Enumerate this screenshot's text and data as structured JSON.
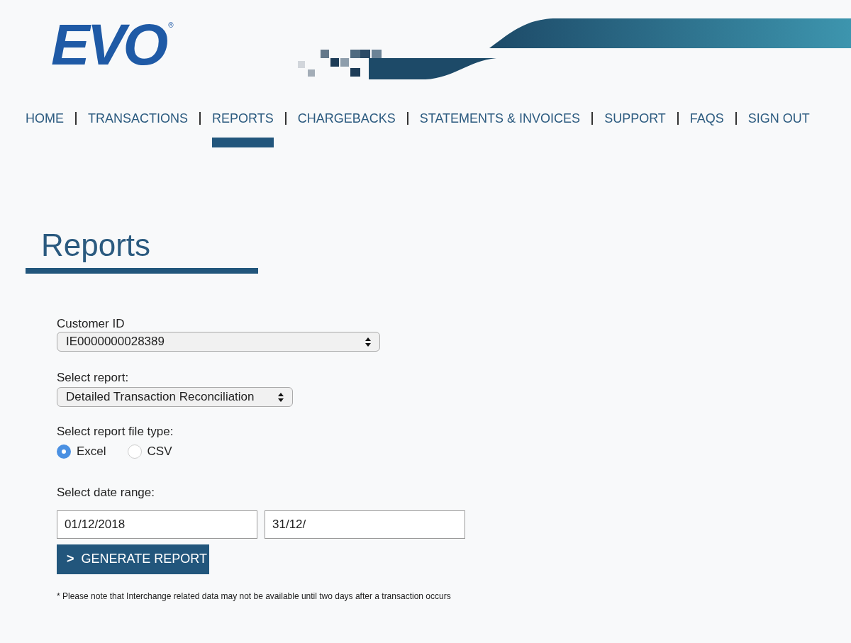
{
  "logo": {
    "text": "EVO",
    "mark": "®"
  },
  "nav": [
    {
      "label": "HOME",
      "selected": false
    },
    {
      "label": "TRANSACTIONS",
      "selected": false
    },
    {
      "label": "REPORTS",
      "selected": true
    },
    {
      "label": "CHARGEBACKS",
      "selected": false
    },
    {
      "label": "STATEMENTS & INVOICES",
      "selected": false
    },
    {
      "label": "SUPPORT",
      "selected": false
    },
    {
      "label": "FAQS",
      "selected": false
    },
    {
      "label": "SIGN OUT",
      "selected": false
    }
  ],
  "page_title": "Reports",
  "customer_id": {
    "label": "Customer ID",
    "value": "IE0000000028389"
  },
  "report": {
    "label": "Select report:",
    "value": "Detailed Transaction Reconciliation"
  },
  "file_type": {
    "label": "Select report file type:",
    "options": [
      {
        "label": "Excel",
        "selected": true
      },
      {
        "label": "CSV",
        "selected": false
      }
    ]
  },
  "date_range": {
    "label": "Select date range:",
    "from": "01/12/2018",
    "to": "31/12/"
  },
  "generate_button": {
    "icon": ">",
    "label": "GENERATE REPORT"
  },
  "note": "* Please note that Interchange related data may not be available until two days after a transaction occurs"
}
